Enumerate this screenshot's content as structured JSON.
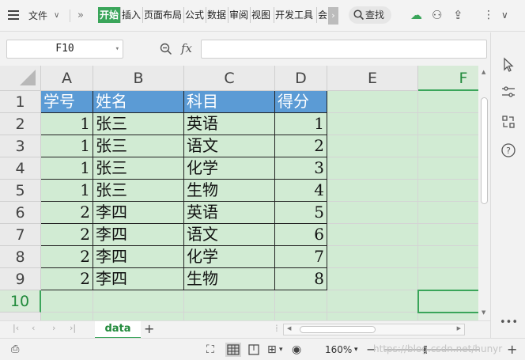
{
  "menu": {
    "file_label": "文件",
    "tabs": [
      {
        "label": "开始",
        "active": true
      },
      {
        "label": "插入"
      },
      {
        "label": "页面布局"
      },
      {
        "label": "公式"
      },
      {
        "label": "数据"
      },
      {
        "label": "审阅"
      },
      {
        "label": "视图"
      },
      {
        "label": "开发工具"
      },
      {
        "label": "会"
      }
    ],
    "search_label": "查找"
  },
  "formula_bar": {
    "name_box": "F10",
    "fx_label": "fx",
    "formula": ""
  },
  "sheet": {
    "columns": [
      "A",
      "B",
      "C",
      "D",
      "E",
      "F"
    ],
    "selected_column": "F",
    "rows": [
      "1",
      "2",
      "3",
      "4",
      "5",
      "6",
      "7",
      "8",
      "9",
      "10"
    ],
    "selected_row": "10",
    "header": [
      "学号",
      "姓名",
      "科目",
      "得分"
    ],
    "data": [
      [
        "1",
        "张三",
        "英语",
        "1"
      ],
      [
        "1",
        "张三",
        "语文",
        "2"
      ],
      [
        "1",
        "张三",
        "化学",
        "3"
      ],
      [
        "1",
        "张三",
        "生物",
        "4"
      ],
      [
        "2",
        "李四",
        "英语",
        "5"
      ],
      [
        "2",
        "李四",
        "语文",
        "6"
      ],
      [
        "2",
        "李四",
        "化学",
        "7"
      ],
      [
        "2",
        "李四",
        "生物",
        "8"
      ]
    ],
    "active_cell": "F10"
  },
  "sheet_tabs": [
    {
      "label": "data",
      "active": true
    }
  ],
  "status": {
    "zoom": "160%",
    "watermark": "https://blog.csdn.net/hunyr"
  },
  "colors": {
    "accent": "#3aa55a",
    "header_fill": "#5b9bd5",
    "cell_fill": "#d1ebd3"
  }
}
